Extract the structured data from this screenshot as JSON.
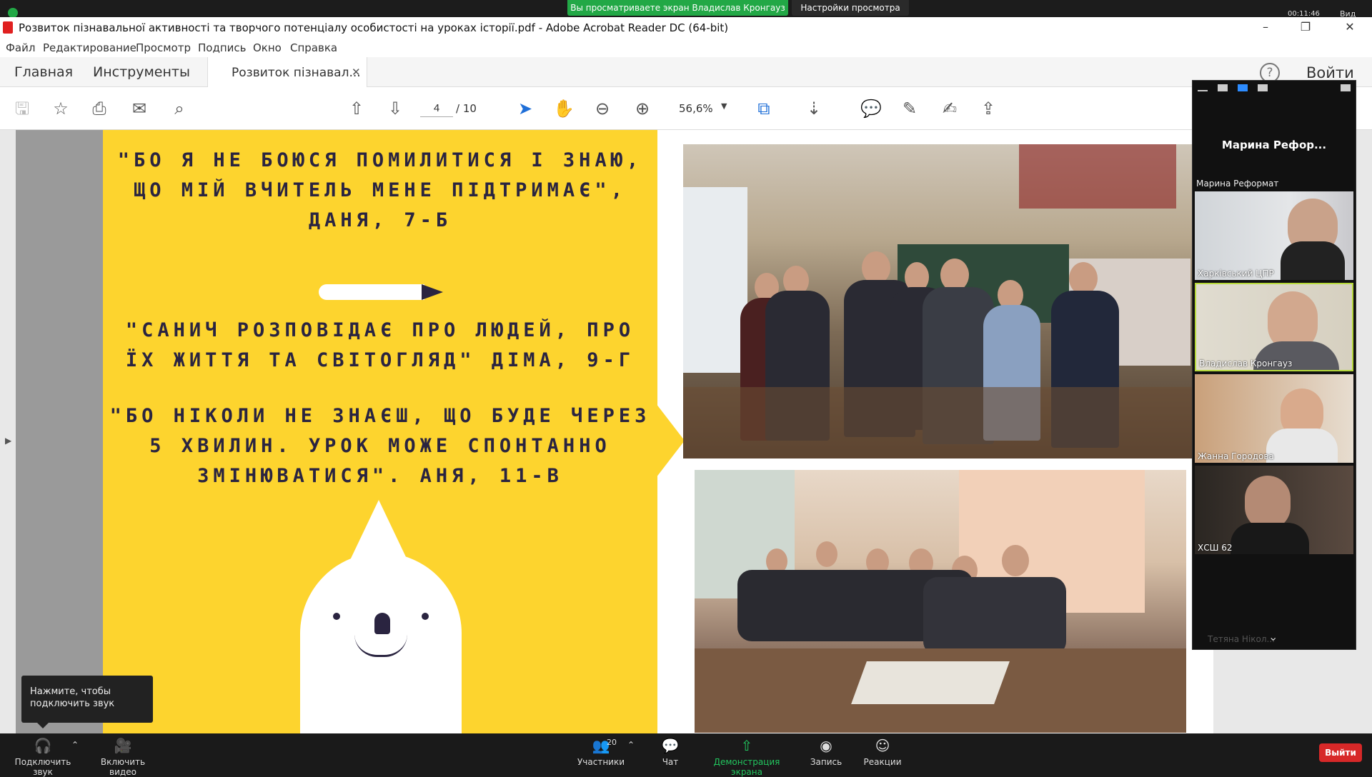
{
  "zoom_top": {
    "share_banner": "Вы просматриваете экран Владислав Кронгауз",
    "view_settings": "Настройки просмотра",
    "timer": "00:11:46",
    "view_label": "Вид"
  },
  "window": {
    "title": "Розвиток пізнавальної активності та творчого потенціалу особистості на уроках історії.pdf - Adobe Acrobat Reader DC (64-bit)",
    "minimize": "–",
    "restore": "❐",
    "close": "✕"
  },
  "menu": [
    "Файл",
    "Редактирование",
    "Просмотр",
    "Подпись",
    "Окно",
    "Справка"
  ],
  "tabs": {
    "home": "Главная",
    "tools": "Инструменты",
    "doc": "Розвиток пізнавал...",
    "close": "✕",
    "help": "?",
    "signin": "Войти"
  },
  "toolbar": {
    "page_current": "4",
    "page_total": "/  10",
    "zoom": "56,6%"
  },
  "slide": {
    "quote1": "\"Бо я не боюся помилитися і знаю, що мій вчитель мене підтримає\", Даня, 7-Б",
    "quote2": "\"Санич розповідає про людей, про їх життя та світогляд\" Діма, 9-Г",
    "quote3": "\"Бо ніколи не знаєш, що буде через 5 хвилин. Урок може спонтанно змінюватися\". Аня, 11-В"
  },
  "tooltip": "Нажмите, чтобы подключить звук",
  "zoom_bottom": {
    "audio": "Подключить звук",
    "video": "Включить видео",
    "participants": "Участники",
    "participants_count": "20",
    "chat": "Чат",
    "share": "Демонстрация экрана",
    "record": "Запись",
    "reactions": "Реакции",
    "leave": "Выйти"
  },
  "panel": {
    "speaker_display": "Марина  Рефор...",
    "speaker_label": "Марина Реформат",
    "tiles": [
      {
        "name": "Харківський ЦПР"
      },
      {
        "name": "Владислав Кронгауз"
      },
      {
        "name": "Жанна Городова"
      },
      {
        "name": "ХСШ 62"
      }
    ],
    "more": "Тетяна Нікол..."
  },
  "colors": {
    "slide_yellow": "#fdd42e",
    "slide_ink": "#2a2440",
    "zoom_green": "#22a846",
    "leave_red": "#d72828"
  }
}
